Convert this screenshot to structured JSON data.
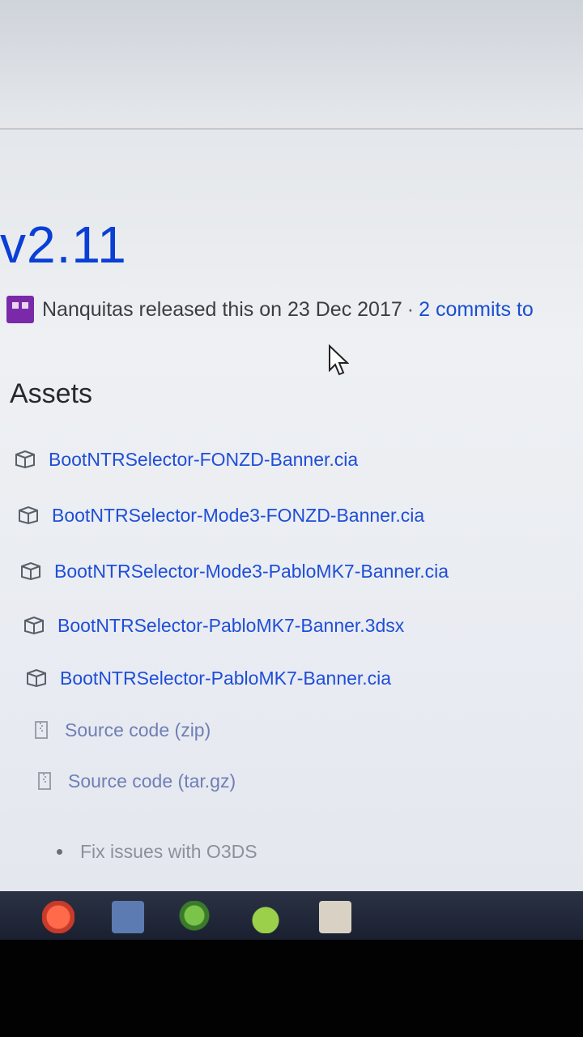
{
  "release": {
    "version": "v2.11",
    "author": "Nanquitas",
    "released_text": "released this on 23 Dec 2017",
    "separator": "·",
    "commits_text": "2 commits to"
  },
  "assets": {
    "heading": "Assets",
    "items": [
      {
        "label": "BootNTRSelector-FONZD-Banner.cia",
        "icon": "package-icon"
      },
      {
        "label": "BootNTRSelector-Mode3-FONZD-Banner.cia",
        "icon": "package-icon"
      },
      {
        "label": "BootNTRSelector-Mode3-PabloMK7-Banner.cia",
        "icon": "package-icon"
      },
      {
        "label": "BootNTRSelector-PabloMK7-Banner.3dsx",
        "icon": "package-icon"
      },
      {
        "label": "BootNTRSelector-PabloMK7-Banner.cia",
        "icon": "package-icon"
      },
      {
        "label": "Source code (zip)",
        "icon": "file-zip-icon"
      },
      {
        "label": "Source code (tar.gz)",
        "icon": "file-zip-icon"
      }
    ]
  },
  "notes": {
    "items": [
      "Fix issues with O3DS"
    ]
  },
  "taskbar": {
    "icons": [
      "browser-icon",
      "photos-icon",
      "maps-icon",
      "android-icon",
      "app-icon"
    ]
  }
}
